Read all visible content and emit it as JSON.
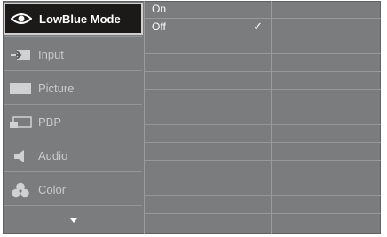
{
  "menu": {
    "items": [
      {
        "label": "LowBlue Mode",
        "icon": "eye-icon",
        "active": true
      },
      {
        "label": "Input",
        "icon": "input-icon",
        "active": false
      },
      {
        "label": "Picture",
        "icon": "picture-icon",
        "active": false
      },
      {
        "label": "PBP",
        "icon": "pbp-icon",
        "active": false
      },
      {
        "label": "Audio",
        "icon": "speaker-icon",
        "active": false
      },
      {
        "label": "Color",
        "icon": "color-icon",
        "active": false
      }
    ],
    "more_icon": "triangle-down-icon"
  },
  "options": {
    "items": [
      {
        "label": "On",
        "selected": false
      },
      {
        "label": "Off",
        "selected": true
      }
    ],
    "check_mark": "✓"
  },
  "colors": {
    "panel_bg": "#7a7c7e",
    "active_bg": "#1c1a18",
    "text": "#ffffff",
    "muted_text": "#c9cacc"
  }
}
